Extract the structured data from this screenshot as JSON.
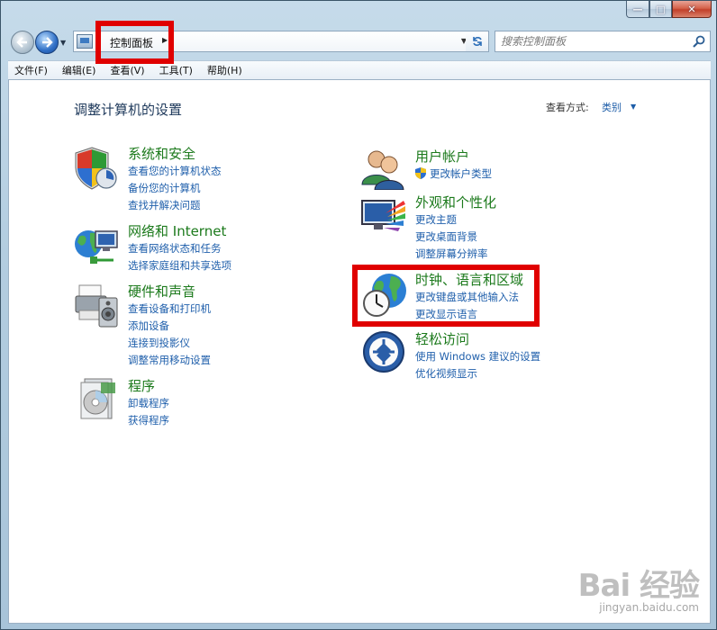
{
  "window": {
    "caption_min_glyph": "—",
    "caption_max_glyph": "□",
    "caption_close_glyph": "✕"
  },
  "nav": {
    "breadcrumb": "控制面板",
    "search_placeholder": "搜索控制面板"
  },
  "menu": [
    "文件(F)",
    "编辑(E)",
    "查看(V)",
    "工具(T)",
    "帮助(H)"
  ],
  "main": {
    "title": "调整计算机的设置",
    "view_by_label": "查看方式:",
    "view_by_value": "类别"
  },
  "categories_left": [
    {
      "title": "系统和安全",
      "icon": "shield-icon",
      "links": [
        "查看您的计算机状态",
        "备份您的计算机",
        "查找并解决问题"
      ]
    },
    {
      "title": "网络和 Internet",
      "icon": "network-icon",
      "links": [
        "查看网络状态和任务",
        "选择家庭组和共享选项"
      ]
    },
    {
      "title": "硬件和声音",
      "icon": "printer-icon",
      "links": [
        "查看设备和打印机",
        "添加设备",
        "连接到投影仪",
        "调整常用移动设置"
      ]
    },
    {
      "title": "程序",
      "icon": "programs-icon",
      "links": [
        "卸载程序",
        "获得程序"
      ]
    }
  ],
  "categories_right": [
    {
      "title": "用户帐户",
      "icon": "users-icon",
      "links": [
        "更改帐户类型"
      ]
    },
    {
      "title": "外观和个性化",
      "icon": "display-icon",
      "links": [
        "更改主题",
        "更改桌面背景",
        "调整屏幕分辨率"
      ]
    },
    {
      "title": "时钟、语言和区域",
      "icon": "globe-clock-icon",
      "links": [
        "更改键盘或其他输入法",
        "更改显示语言"
      ]
    },
    {
      "title": "轻松访问",
      "icon": "accessibility-icon",
      "links": [
        "使用 Windows 建议的设置",
        "优化视频显示"
      ]
    }
  ],
  "watermark": {
    "logo": "Bai 经验",
    "url": "jingyan.baidu.com"
  },
  "colors": {
    "category_title": "#1c7a1c",
    "link": "#1f5fab",
    "highlight": "#e00000"
  }
}
